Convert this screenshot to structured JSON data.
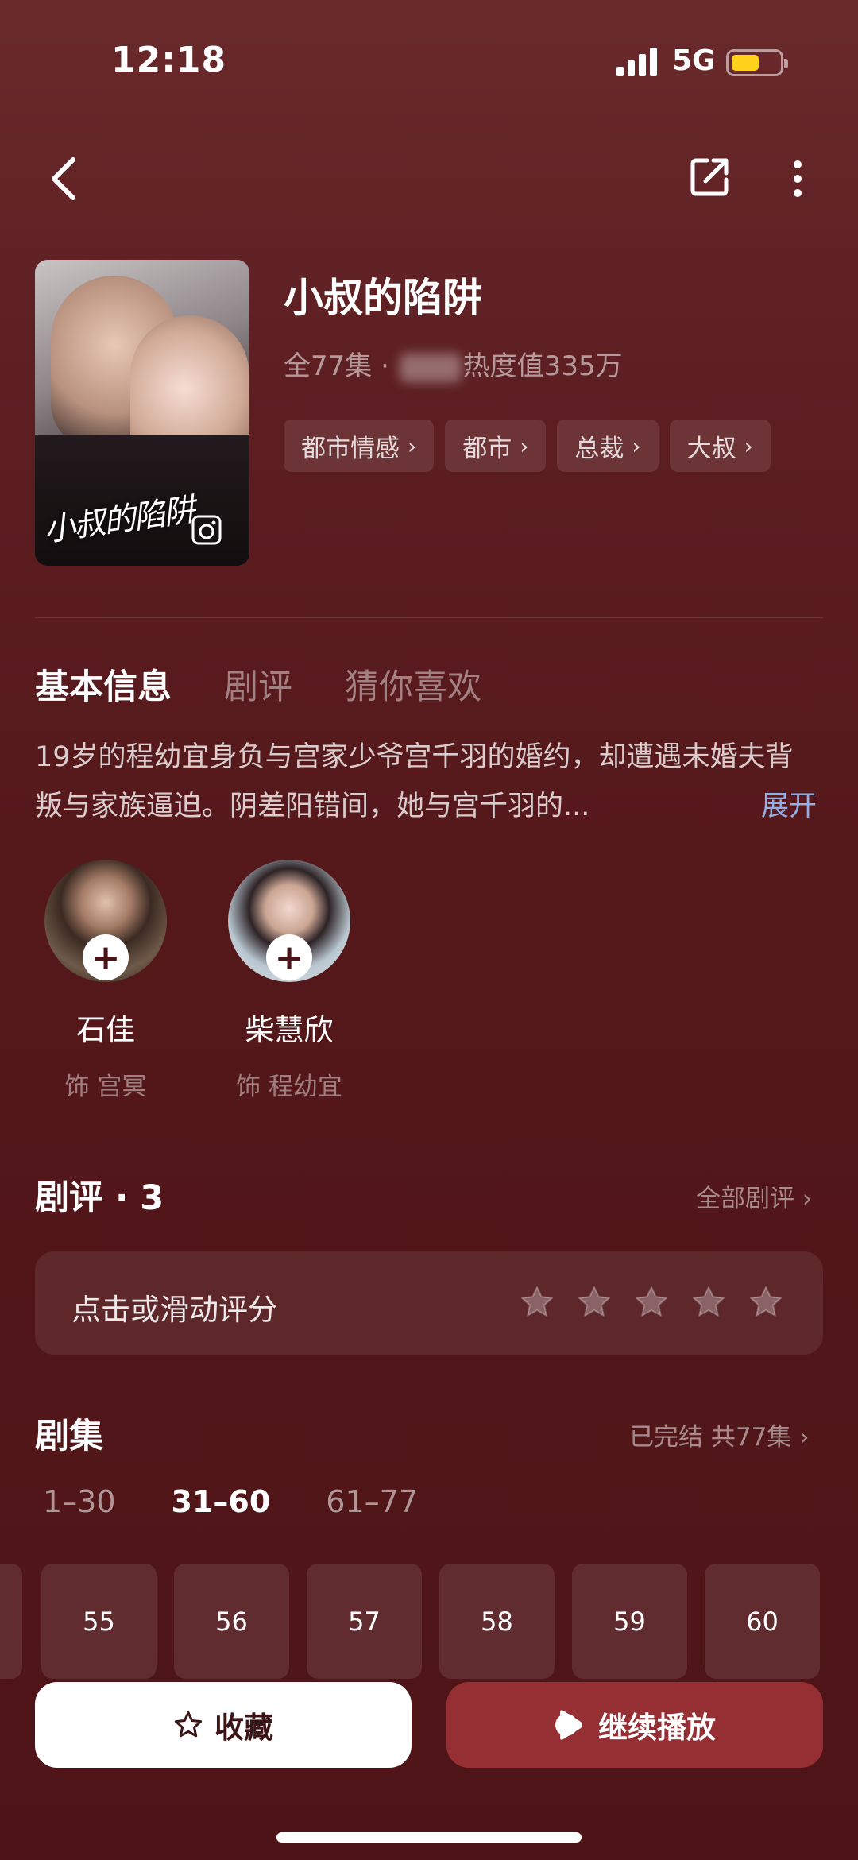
{
  "status_bar": {
    "time": "12:18",
    "network": "5G",
    "battery_color": "#ffd21e"
  },
  "nav": {
    "back_icon": "chevron-left-icon",
    "share_icon": "share-icon",
    "more_icon": "more-vertical-icon"
  },
  "drama": {
    "title": "小叔的陷阱",
    "poster_title": "小叔的陷阱",
    "episodes_prefix": "全77集 · ",
    "heat": "热度值335万",
    "tags": [
      "都市情感",
      "都市",
      "总裁",
      "大叔"
    ]
  },
  "tabs": [
    "基本信息",
    "剧评",
    "猜你喜欢"
  ],
  "description": {
    "text": "19岁的程幼宜身负与宫家少爷宫千羽的婚约，却遭遇未婚夫背叛与家族逼迫。阴差阳错间，她与宫千羽的...",
    "expand": "展开"
  },
  "cast": [
    {
      "name": "石佳",
      "role": "饰 宫冥"
    },
    {
      "name": "柴慧欣",
      "role": "饰 程幼宜"
    }
  ],
  "reviews": {
    "title": "剧评 · 3",
    "all_link": "全部剧评",
    "rate_prompt": "点击或滑动评分",
    "star_count": 5
  },
  "episodes": {
    "title": "剧集",
    "status": "已完结 共77集",
    "ranges": [
      "1–30",
      "31–60",
      "61–77"
    ],
    "active_range": 1,
    "visible": [
      "55",
      "56",
      "57",
      "58",
      "59",
      "60"
    ]
  },
  "actions": {
    "collect": "收藏",
    "play": "继续播放"
  },
  "colors": {
    "background": "#55181b",
    "play_button": "#962f33",
    "expand_link": "#8fb0e6"
  }
}
